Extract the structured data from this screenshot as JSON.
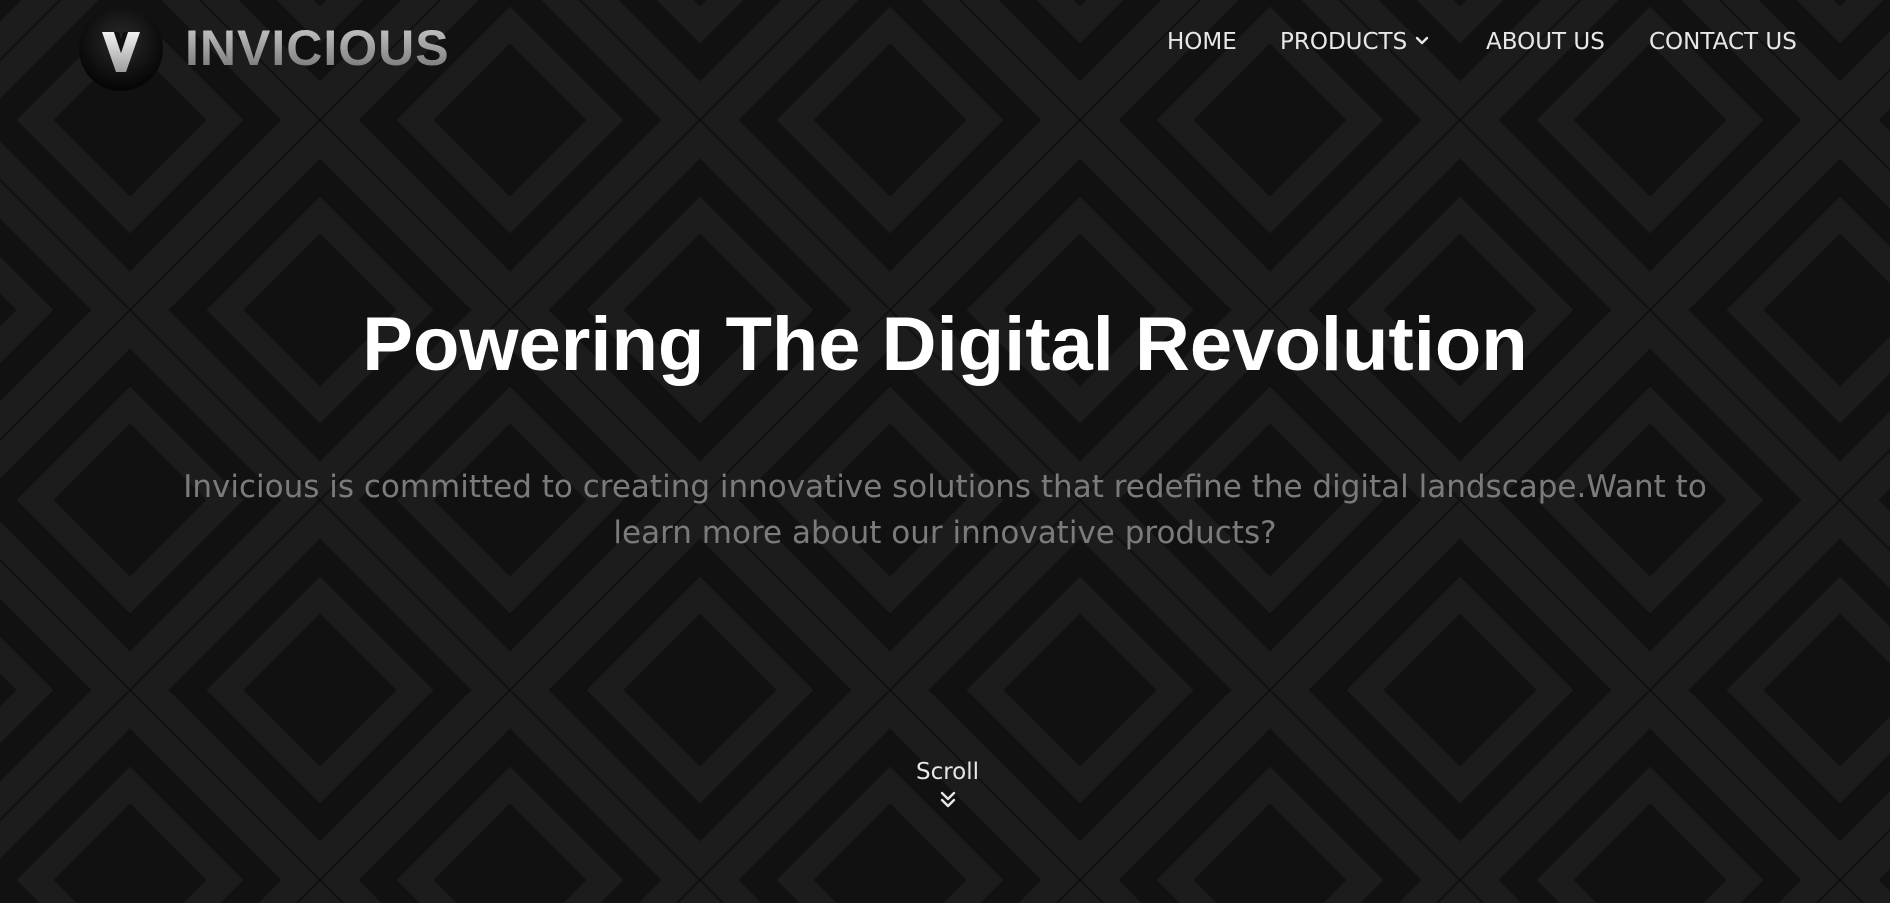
{
  "brand": {
    "name": "INVICIOUS",
    "logo_icon": "v-logo-icon"
  },
  "nav": {
    "home": "HOME",
    "products": "PRODUCTS",
    "products_icon": "chevron-down-icon",
    "about": "ABOUT US",
    "contact": "CONTACT US"
  },
  "hero": {
    "title": "Powering The Digital Revolution",
    "subtitle": "Invicious is committed to creating innovative solutions that redefine the digital landscape.Want to learn more about our innovative products?"
  },
  "scroll": {
    "label": "Scroll",
    "icon": "double-chevron-down-icon"
  },
  "colors": {
    "background": "#111111",
    "pattern": "#1c1c1c",
    "title": "#ffffff",
    "subtitle": "#7b7b7b",
    "nav_text": "#e8e8e8"
  }
}
